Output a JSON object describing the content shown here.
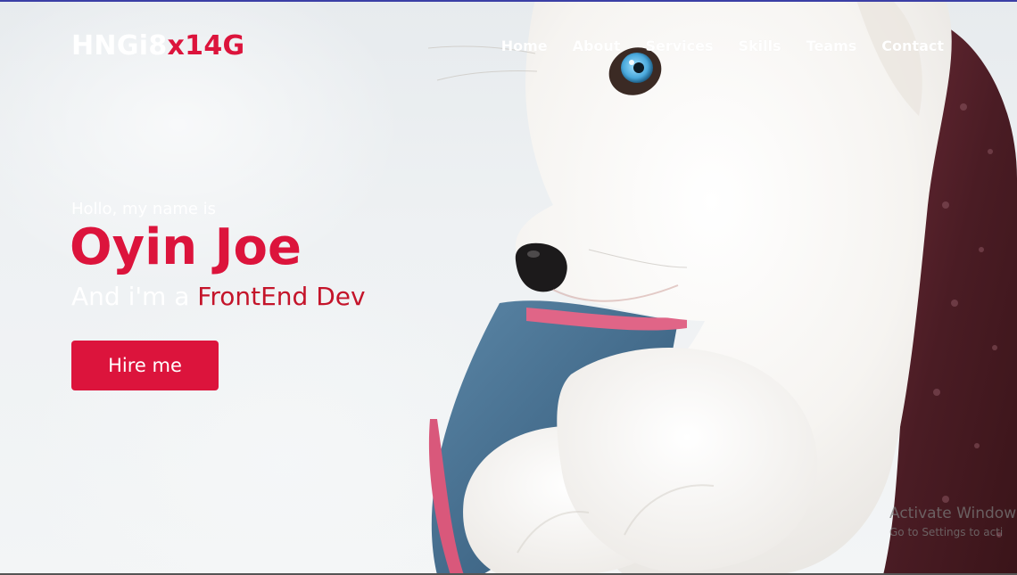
{
  "brand": {
    "main": "HNGi8",
    "accent": "x14G"
  },
  "nav": {
    "items": [
      {
        "label": "Home"
      },
      {
        "label": "About"
      },
      {
        "label": "Services"
      },
      {
        "label": "Skills"
      },
      {
        "label": "Teams"
      },
      {
        "label": "Contact"
      }
    ]
  },
  "hero": {
    "greeting": "Hollo, my name is",
    "name": "Oyin Joe",
    "role_prefix": "And i'm a ",
    "role_accent": "FrontEnd Dev",
    "cta_label": "Hire me",
    "image": "white-husky-puppy-photo"
  },
  "watermark": {
    "title": "Activate Window",
    "subtitle": "Go to Settings to acti"
  },
  "colors": {
    "accent": "#dc143c",
    "role_accent": "#c4142a",
    "text_light": "#ffffff",
    "top_border": "#3b3fa6"
  }
}
